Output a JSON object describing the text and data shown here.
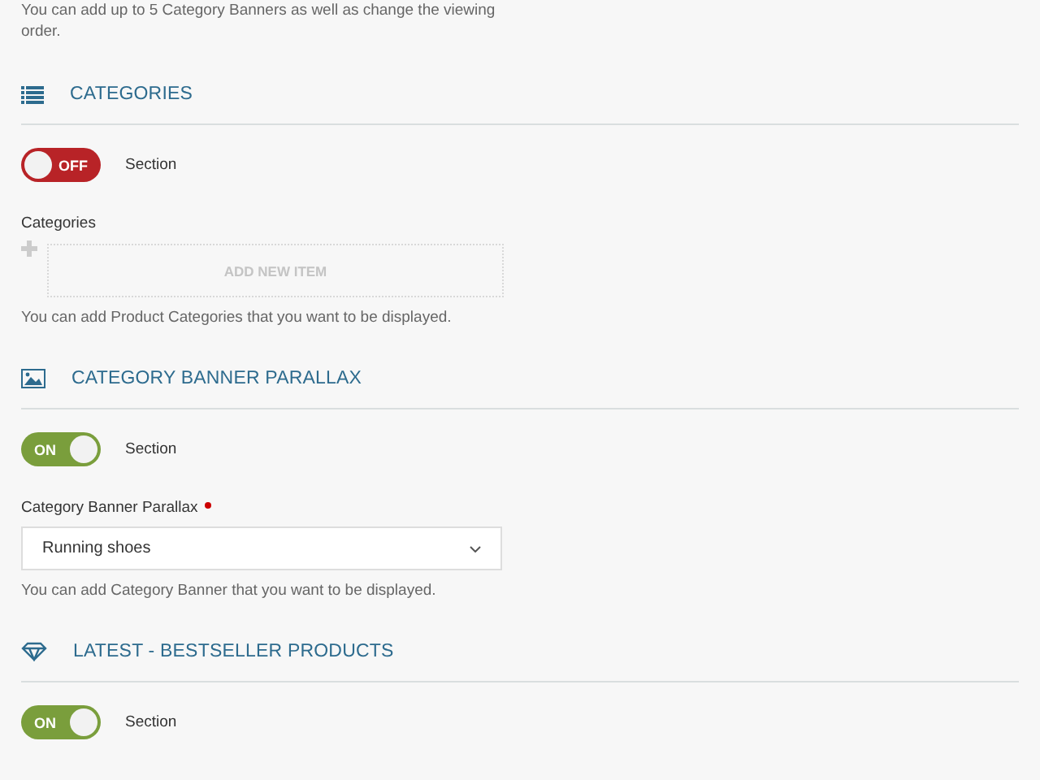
{
  "intro": "You can add up to 5 Category Banners as well as change the viewing order.",
  "sections": [
    {
      "title": "CATEGORIES",
      "toggle": {
        "on": false,
        "label": "OFF"
      },
      "toggle_caption": "Section",
      "field": {
        "kind": "repeater",
        "label": "Categories",
        "button": "ADD NEW ITEM"
      },
      "hint": "You can add Product Categories that you want to be displayed."
    },
    {
      "title": "CATEGORY BANNER PARALLAX",
      "toggle": {
        "on": true,
        "label": "ON"
      },
      "toggle_caption": "Section",
      "field": {
        "kind": "select",
        "label": "Category Banner Parallax",
        "required": true,
        "value": "Running shoes"
      },
      "hint": "You can add Category Banner that you want to be displayed."
    },
    {
      "title": "LATEST - BESTSELLER PRODUCTS",
      "toggle": {
        "on": true,
        "label": "ON"
      },
      "toggle_caption": "Section"
    }
  ]
}
